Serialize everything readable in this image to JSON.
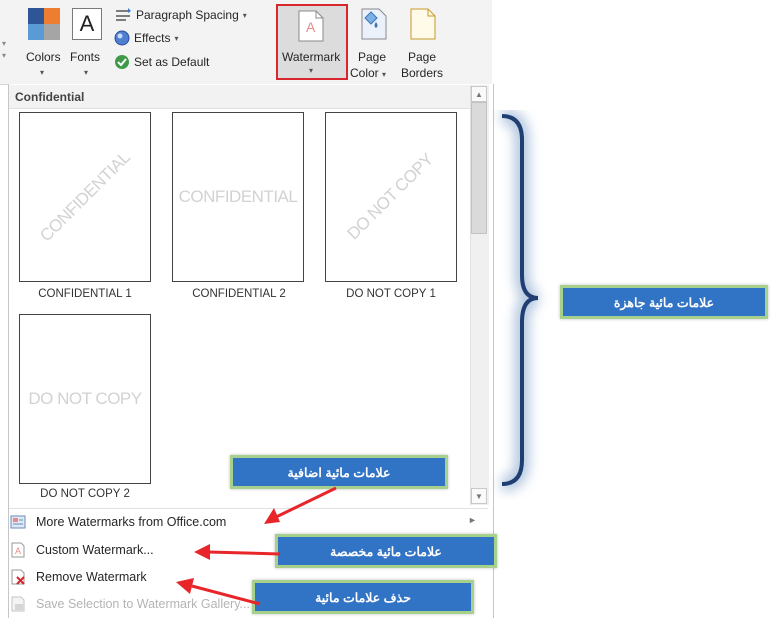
{
  "ribbon": {
    "colors_label": "Colors",
    "fonts_label": "Fonts",
    "fonts_glyph": "A",
    "paragraph_spacing_label": "Paragraph Spacing",
    "effects_label": "Effects",
    "set_as_default_label": "Set as Default",
    "watermark_label": "Watermark",
    "page_color_label_1": "Page",
    "page_color_label_2": "Color",
    "page_borders_label_1": "Page",
    "page_borders_label_2": "Borders",
    "dropdown_caret": "▾"
  },
  "gallery": {
    "section_header": "Confidential",
    "items": [
      {
        "caption": "CONFIDENTIAL 1",
        "watermark_text": "CONFIDENTIAL",
        "diagonal": true
      },
      {
        "caption": "CONFIDENTIAL 2",
        "watermark_text": "CONFIDENTIAL",
        "diagonal": false
      },
      {
        "caption": "DO NOT COPY 1",
        "watermark_text": "DO NOT COPY",
        "diagonal": true
      },
      {
        "caption": "DO NOT COPY 2",
        "watermark_text": "DO NOT COPY",
        "diagonal": false
      }
    ]
  },
  "menu": {
    "more_watermarks": "More Watermarks from Office.com",
    "custom_watermark": "Custom Watermark...",
    "remove_watermark": "Remove Watermark",
    "save_selection": "Save Selection to Watermark Gallery..."
  },
  "callouts": {
    "ready_watermarks": "علامات مائية جاهزة",
    "more_watermarks": "علامات مائية اضافية",
    "custom_watermarks": "علامات مائية مخصصة",
    "remove_watermarks": "حذف علامات مائية"
  },
  "colors": {
    "callout_fill": "#3173c4",
    "callout_border": "#a8d08d",
    "arrow": "#e8262a",
    "highlight_border": "#d7262e",
    "brace": "#1f3f73"
  }
}
